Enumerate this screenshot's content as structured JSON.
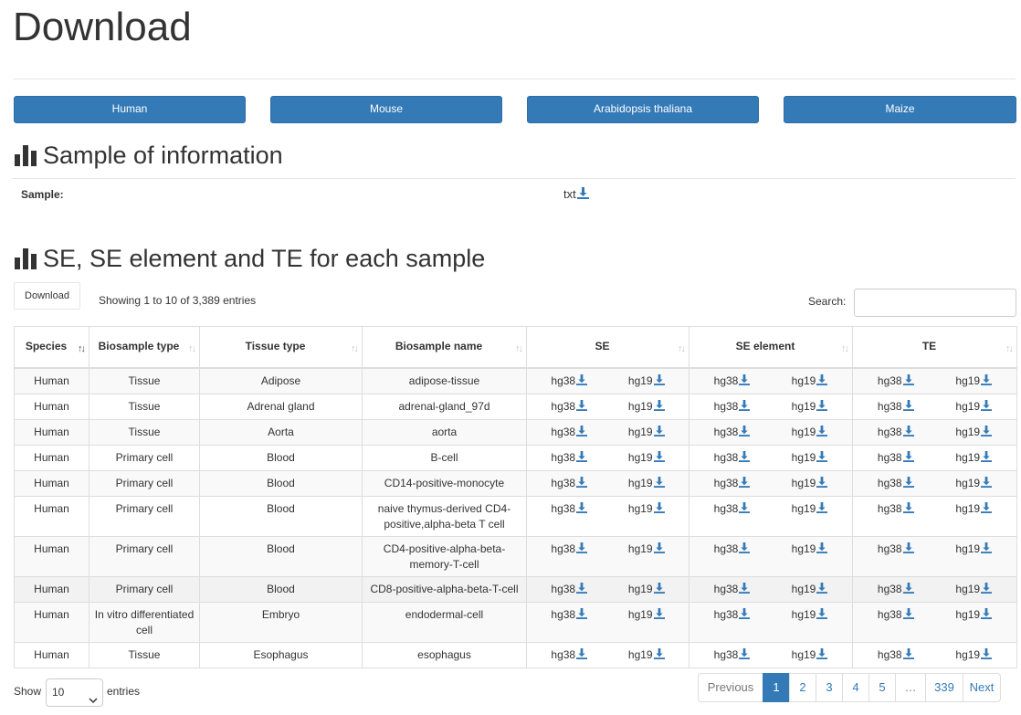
{
  "page": {
    "title": "Download"
  },
  "species_buttons": [
    "Human",
    "Mouse",
    "Arabidopsis thaliana",
    "Maize"
  ],
  "section1": {
    "title": "Sample of information",
    "sample_label": "Sample:",
    "sample_file": "txt"
  },
  "section2": {
    "title": "SE, SE element and TE for each sample",
    "download_button": "Download",
    "info": "Showing 1 to 10 of 3,389 entries",
    "search_label": "Search:",
    "search_value": "",
    "columns": [
      "Species",
      "Biosample type",
      "Tissue type",
      "Biosample name",
      "SE",
      "SE element",
      "TE"
    ],
    "genome_links": [
      "hg38",
      "hg19"
    ],
    "rows": [
      {
        "species": "Human",
        "biosample_type": "Tissue",
        "tissue_type": "Adipose",
        "biosample_name": "adipose-tissue"
      },
      {
        "species": "Human",
        "biosample_type": "Tissue",
        "tissue_type": "Adrenal gland",
        "biosample_name": "adrenal-gland_97d"
      },
      {
        "species": "Human",
        "biosample_type": "Tissue",
        "tissue_type": "Aorta",
        "biosample_name": "aorta"
      },
      {
        "species": "Human",
        "biosample_type": "Primary cell",
        "tissue_type": "Blood",
        "biosample_name": "B-cell"
      },
      {
        "species": "Human",
        "biosample_type": "Primary cell",
        "tissue_type": "Blood",
        "biosample_name": "CD14-positive-monocyte"
      },
      {
        "species": "Human",
        "biosample_type": "Primary cell",
        "tissue_type": "Blood",
        "biosample_name": "naive thymus-derived CD4-positive,alpha-beta T cell"
      },
      {
        "species": "Human",
        "biosample_type": "Primary cell",
        "tissue_type": "Blood",
        "biosample_name": "CD4-positive-alpha-beta-memory-T-cell"
      },
      {
        "species": "Human",
        "biosample_type": "Primary cell",
        "tissue_type": "Blood",
        "biosample_name": "CD8-positive-alpha-beta-T-cell"
      },
      {
        "species": "Human",
        "biosample_type": "In vitro differentiated cell",
        "tissue_type": "Embryo",
        "biosample_name": "endodermal-cell"
      },
      {
        "species": "Human",
        "biosample_type": "Tissue",
        "tissue_type": "Esophagus",
        "biosample_name": "esophagus"
      }
    ]
  },
  "footer": {
    "show_label": "Show",
    "page_length": "10",
    "entries_label": "entries",
    "pagination": [
      "Previous",
      "1",
      "2",
      "3",
      "4",
      "5",
      "…",
      "339",
      "Next"
    ],
    "active_page": "1"
  },
  "colors": {
    "primary": "#337ab7",
    "border": "#dddddd",
    "stripe": "#f9f9f9"
  },
  "icons": {
    "section": "bar-chart-icon",
    "download": "download-icon",
    "sort": "sort-icon"
  }
}
